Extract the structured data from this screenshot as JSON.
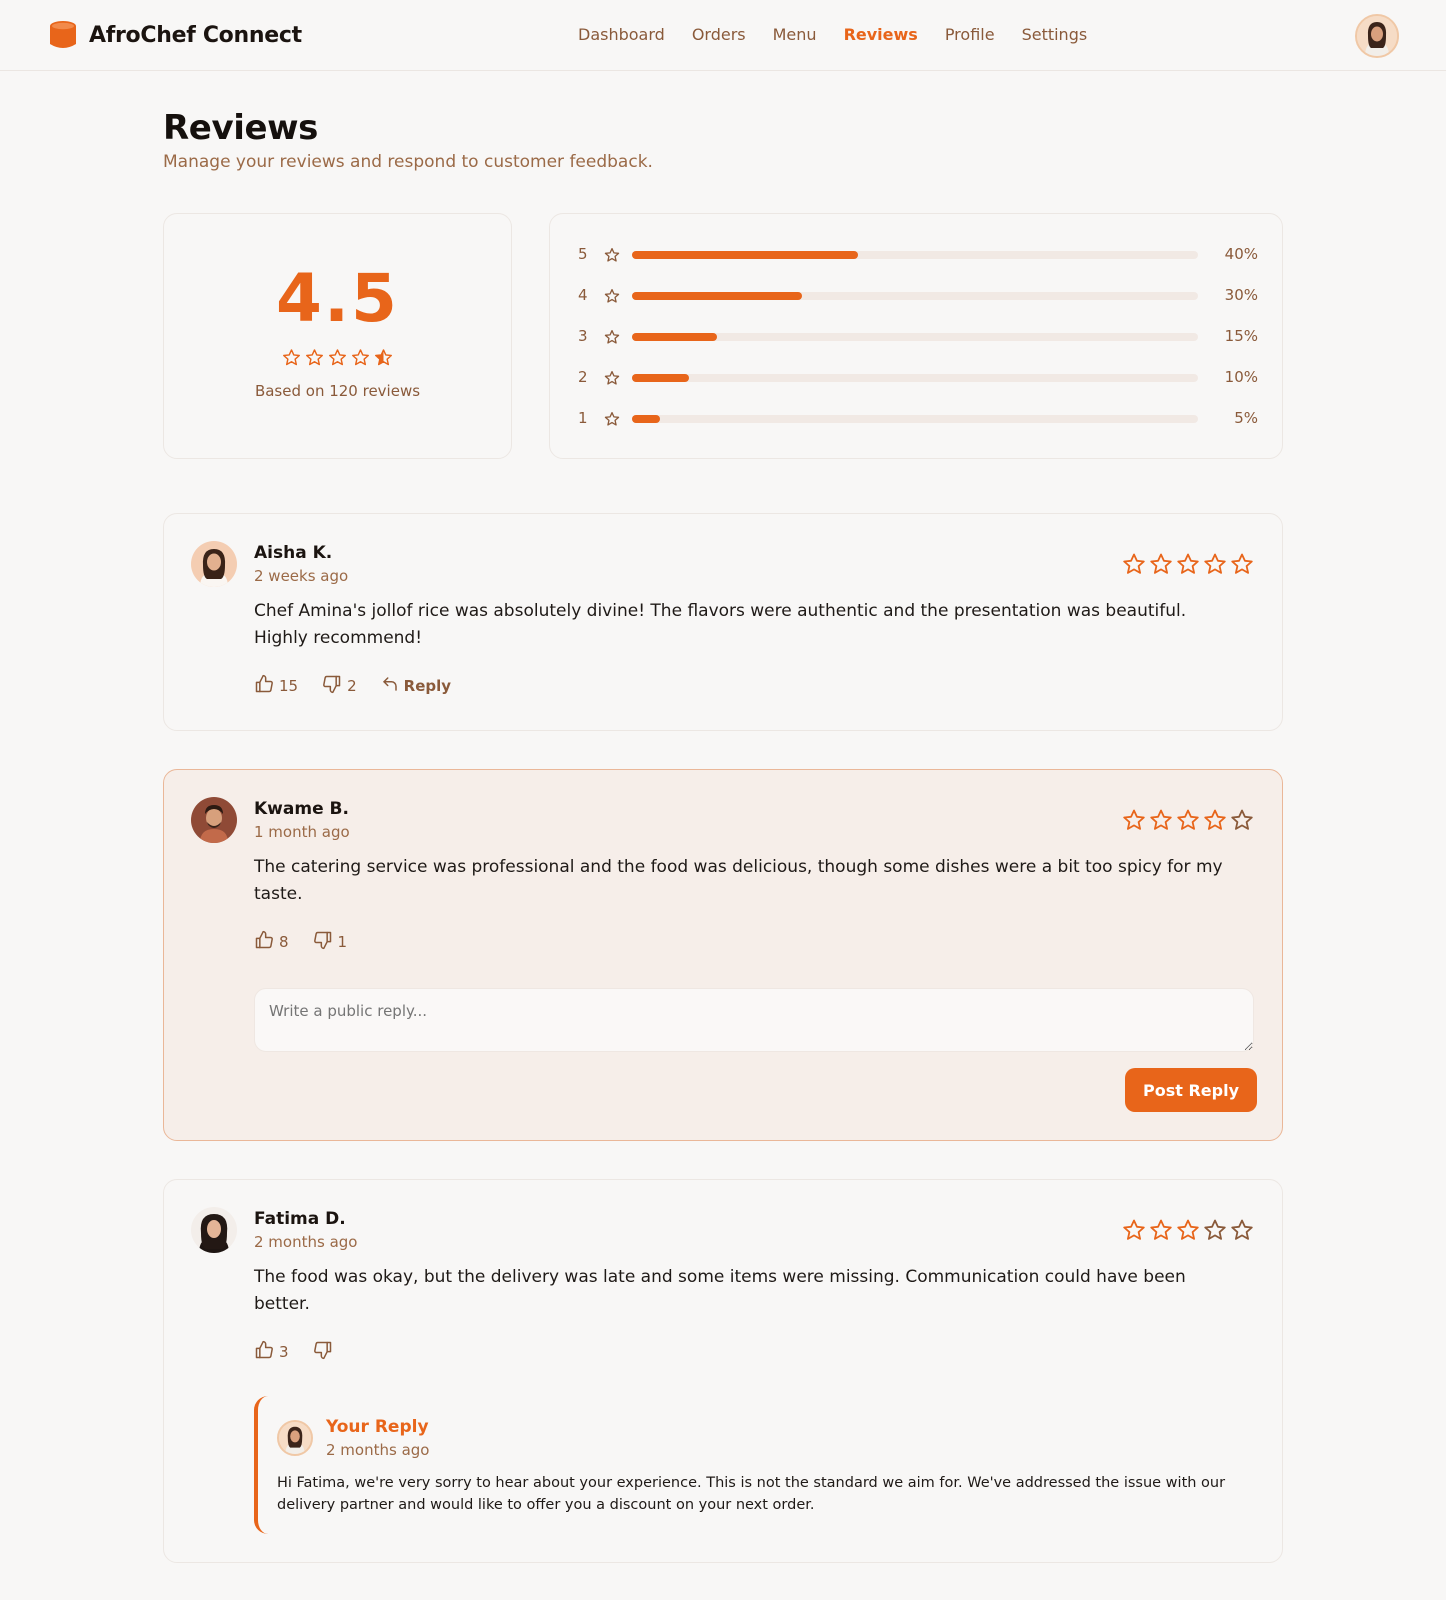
{
  "app": {
    "name": "AfroChef Connect"
  },
  "nav": [
    {
      "label": "Dashboard",
      "active": false
    },
    {
      "label": "Orders",
      "active": false
    },
    {
      "label": "Menu",
      "active": false
    },
    {
      "label": "Reviews",
      "active": true
    },
    {
      "label": "Profile",
      "active": false
    },
    {
      "label": "Settings",
      "active": false
    }
  ],
  "page": {
    "title": "Reviews",
    "subtitle": "Manage your reviews and respond to customer feedback."
  },
  "summary": {
    "rating": "4.5",
    "rating_value": 4.5,
    "caption": "Based on 120 reviews"
  },
  "distribution": [
    {
      "stars": "5",
      "percent_label": "40%",
      "percent": 40
    },
    {
      "stars": "4",
      "percent_label": "30%",
      "percent": 30
    },
    {
      "stars": "3",
      "percent_label": "15%",
      "percent": 15
    },
    {
      "stars": "2",
      "percent_label": "10%",
      "percent": 10
    },
    {
      "stars": "1",
      "percent_label": "5%",
      "percent": 5
    }
  ],
  "reviews": [
    {
      "name": "Aisha K.",
      "date": "2 weeks ago",
      "rating": 5,
      "text": "Chef Amina's jollof rice was absolutely divine! The flavors were authentic and the presentation was beautiful. Highly recommend!",
      "likes": "15",
      "dislikes": "2",
      "reply_label": "Reply"
    },
    {
      "name": "Kwame B.",
      "date": "1 month ago",
      "rating": 4,
      "text": "The catering service was professional and the food was delicious, though some dishes were a bit too spicy for my taste.",
      "likes": "8",
      "dislikes": "1",
      "reply_placeholder": "Write a public reply...",
      "post_button": "Post Reply"
    },
    {
      "name": "Fatima D.",
      "date": "2 months ago",
      "rating": 3,
      "text": "The food was okay, but the delivery was late and some items were missing. Communication could have been better.",
      "likes": "3",
      "dislikes": "",
      "own_reply": {
        "title": "Your Reply",
        "date": "2 months ago",
        "text": "Hi Fatima, we're very sorry to hear about your experience. This is not the standard we aim for. We've addressed the issue with our delivery partner and would like to offer you a discount on your next order."
      }
    }
  ],
  "colors": {
    "accent": "#e8651a",
    "muted": "#8a5a3a"
  }
}
